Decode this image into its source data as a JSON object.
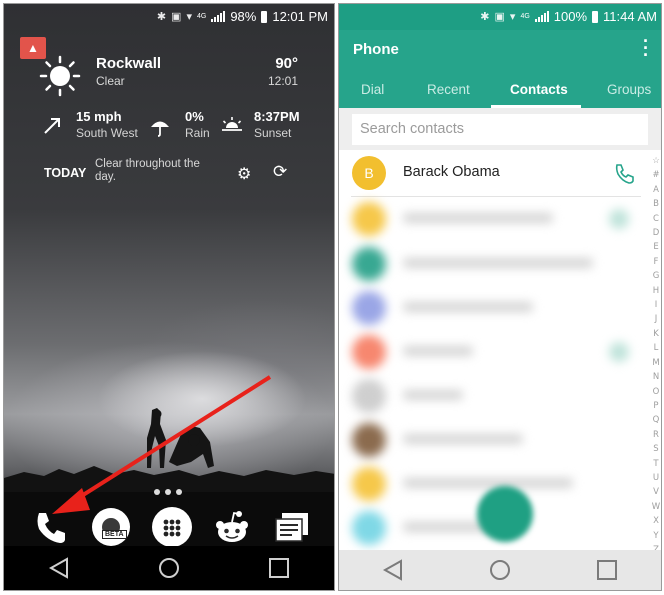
{
  "left": {
    "status_bar": {
      "battery": "98%",
      "time": "12:01 PM",
      "network": "4G"
    },
    "weather": {
      "city": "Rockwall",
      "condition": "Clear",
      "temperature": "90°",
      "time": "12:01",
      "wind_speed": "15 mph",
      "wind_direction": "South West",
      "rain_chance": "0%",
      "rain_label": "Rain",
      "sunset_time": "8:37PM",
      "sunset_label": "Sunset",
      "today_label": "TODAY",
      "today_desc": "Clear throughout the day."
    },
    "dock": {
      "beta_label": "BETA"
    },
    "colors": {
      "alert": "#e2544b"
    }
  },
  "right": {
    "status_bar": {
      "battery": "100%",
      "time": "11:44 AM",
      "network": "4G"
    },
    "app_title": "Phone",
    "tabs": [
      {
        "label": "Dial"
      },
      {
        "label": "Recent"
      },
      {
        "label": "Contacts",
        "active": true
      },
      {
        "label": "Groups"
      }
    ],
    "search": {
      "placeholder": "Search contacts"
    },
    "contacts": [
      {
        "initial": "B",
        "name": "Barack Obama"
      }
    ],
    "alphabet": [
      "☆",
      "#",
      "A",
      "B",
      "C",
      "D",
      "E",
      "F",
      "G",
      "H",
      "I",
      "J",
      "K",
      "L",
      "M",
      "N",
      "O",
      "P",
      "Q",
      "R",
      "S",
      "T",
      "U",
      "V",
      "W",
      "X",
      "Y",
      "Z"
    ],
    "colors": {
      "primary": "#26a48b",
      "status": "#1e9e84",
      "avatar": "#f2bf2f"
    }
  }
}
